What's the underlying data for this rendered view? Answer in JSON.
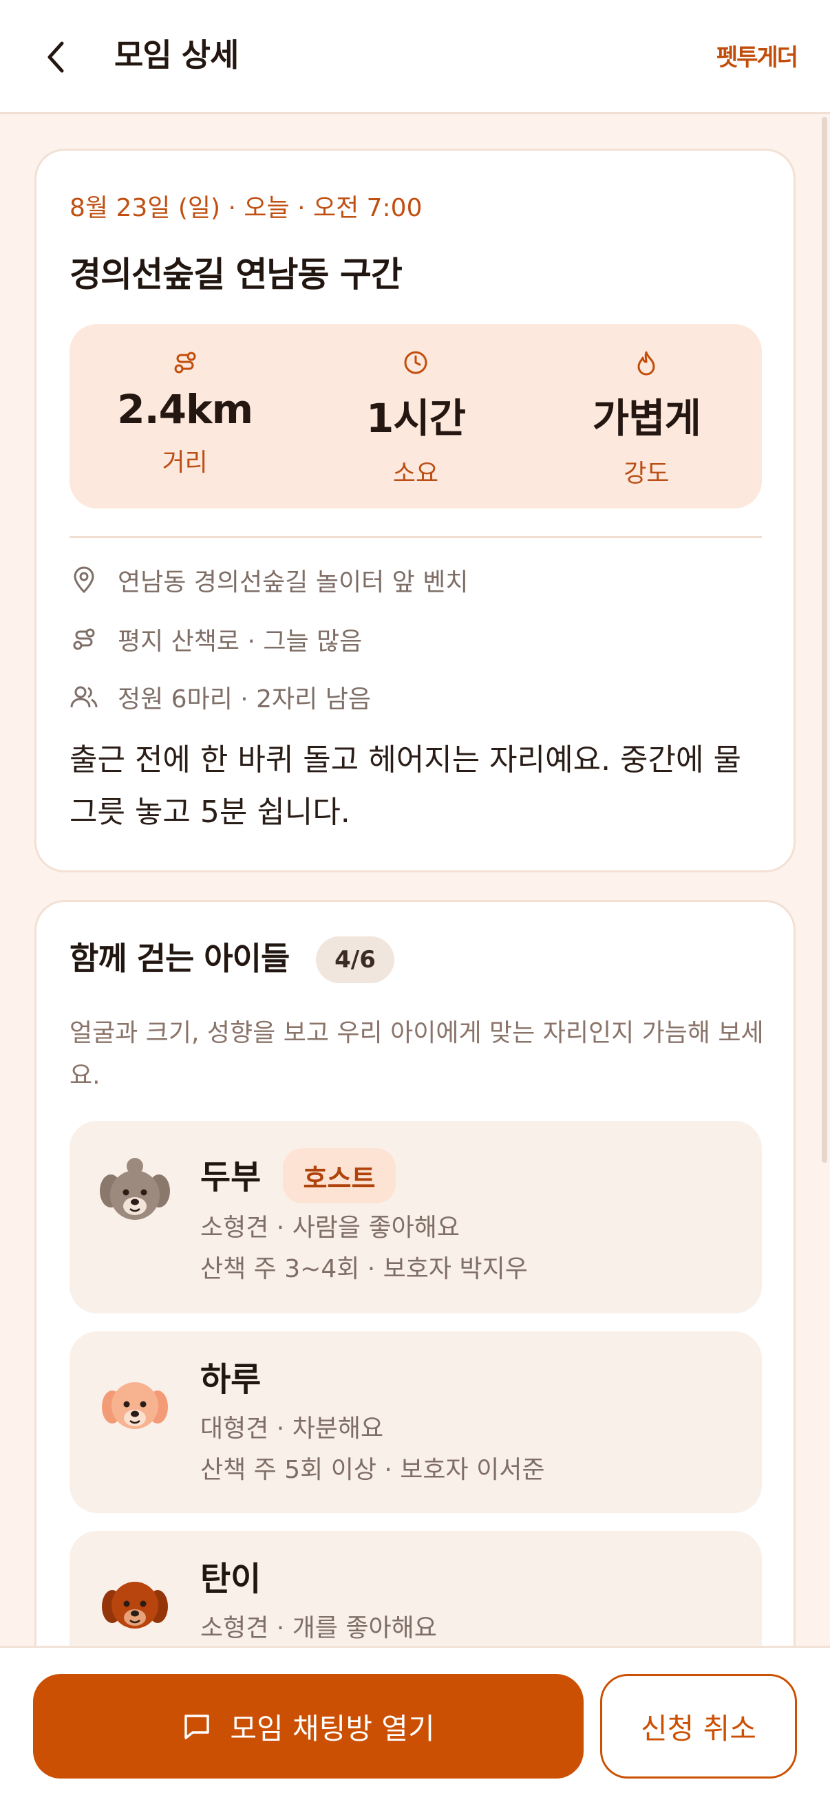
{
  "header": {
    "title": "모임 상세",
    "brand": "펫투게더",
    "back_icon": "chevron-left-icon"
  },
  "meeting": {
    "date_line": "8월 23일 (일) · 오늘 · 오전 7:00",
    "title": "경의선숲길 연남동 구간",
    "stats": [
      {
        "icon": "route-icon",
        "value": "2.4km",
        "label": "거리"
      },
      {
        "icon": "clock-icon",
        "value": "1시간",
        "label": "소요"
      },
      {
        "icon": "flame-icon",
        "value": "가볍게",
        "label": "강도"
      }
    ],
    "info": {
      "location": "연남동 경의선숲길 놀이터 앞 벤치",
      "terrain": "평지 산책로 · 그늘 많음",
      "capacity": "정원 6마리 · 2자리 남음"
    },
    "description": "출근 전에 한 바퀴 돌고 헤어지는 자리예요. 중간에 물그릇 놓고 5분 쉽니다."
  },
  "dogs_section": {
    "title": "함께 걷는 아이들",
    "count": "4/6",
    "subtitle": "얼굴과 크기, 성향을 보고 우리 아이에게 맞는 자리인지 가늠해 보세요.",
    "host_badge": "호스트",
    "dogs": [
      {
        "name": "두부",
        "line1": "소형견 · 사람을 좋아해요",
        "line2": "산책 주 3~4회 · 보호자 박지우",
        "is_host": true,
        "avatar_color": "#9c8a7e"
      },
      {
        "name": "하루",
        "line1": "대형견 · 차분해요",
        "line2": "산책 주 5회 이상 · 보호자 이서준",
        "is_host": false,
        "avatar_color": "#f7b38f"
      },
      {
        "name": "탄이",
        "line1": "소형견 · 개를 좋아해요",
        "line2": "",
        "is_host": false,
        "avatar_color": "#b8440e"
      }
    ]
  },
  "actions": {
    "chat_label": "모임 채팅방 열기",
    "chat_icon": "chat-bubble-icon",
    "cancel_label": "신청 취소"
  },
  "colors": {
    "accent": "#cc5003",
    "background": "#fdf3ec",
    "stats_bg": "#fde8dd"
  }
}
